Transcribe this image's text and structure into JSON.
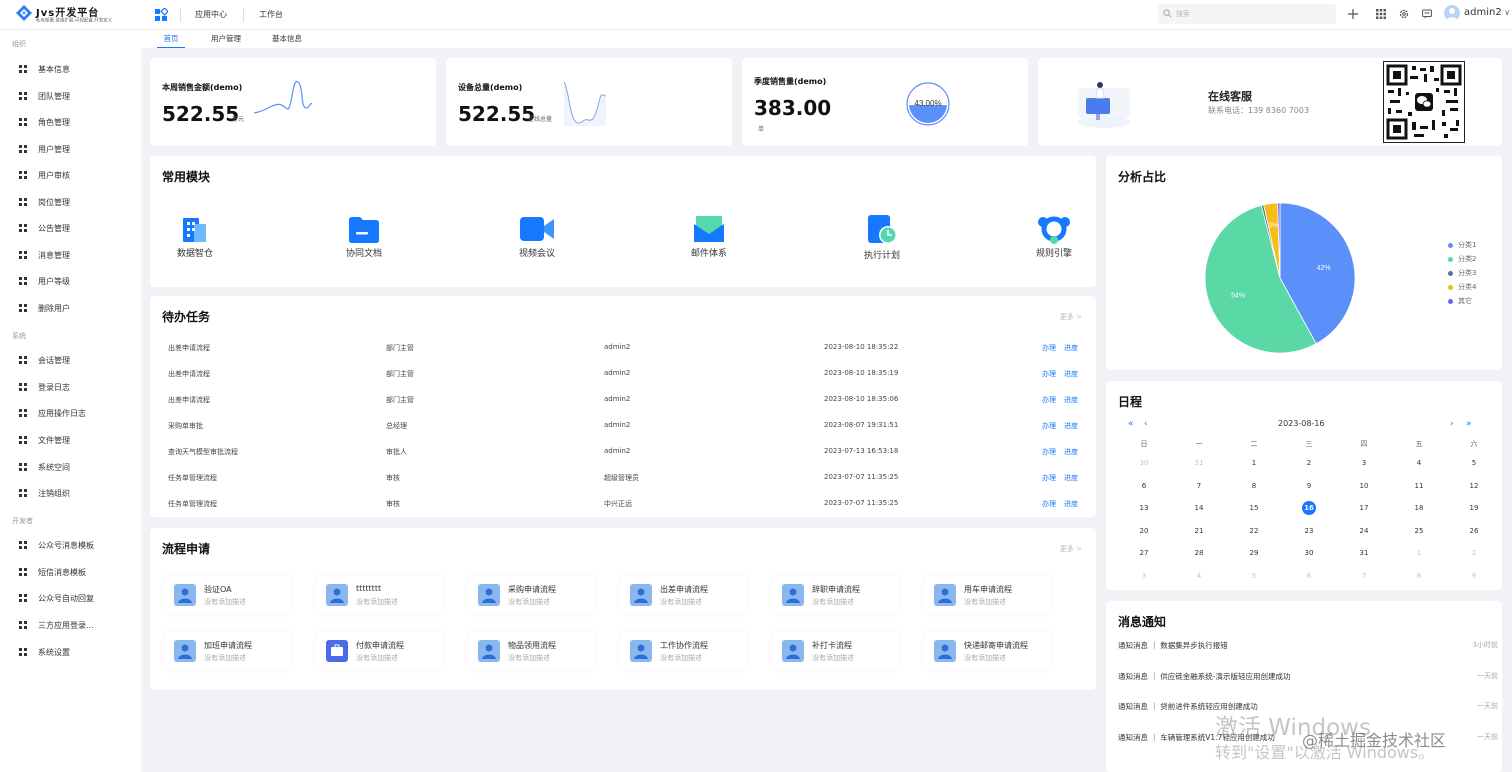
{
  "header": {
    "app_title": "Jvs开发平台",
    "app_subtitle": "私有部署,普通扩展,可视配置,开发定义",
    "nav": [
      "应用中心",
      "工作台"
    ],
    "search_placeholder": "搜索",
    "user": "admin2"
  },
  "sidebar": {
    "groups": [
      {
        "label": "组织",
        "items": [
          "基本信息",
          "团队管理",
          "角色管理",
          "用户管理",
          "用户审核",
          "岗位管理",
          "公告管理",
          "消息管理",
          "用户等级",
          "删除用户"
        ]
      },
      {
        "label": "系统",
        "items": [
          "会话管理",
          "登录日志",
          "应用操作日志",
          "文件管理",
          "系统空间",
          "注销组织"
        ]
      },
      {
        "label": "开发者",
        "items": [
          "公众号消息模板",
          "短信消息模板",
          "公众号自动回复",
          "三方应用登录...",
          "系统设置"
        ]
      }
    ]
  },
  "tabs": [
    "首页",
    "用户管理",
    "基本信息"
  ],
  "stats": [
    {
      "title": "本周销售金额(demo)",
      "value": "522.55",
      "unit": "万元"
    },
    {
      "title": "设备总量(demo)",
      "value": "522.55",
      "unit": "在线总量"
    },
    {
      "title": "季度销售量(demo)",
      "value": "383.00",
      "unit": "单",
      "gauge": "43.00%",
      "gauge_fraction": 0.43
    }
  ],
  "service": {
    "title": "在线客服",
    "phone": "联系电话：139 8360 7003"
  },
  "modules": {
    "title": "常用模块",
    "items": [
      "数据智仓",
      "协同文档",
      "视频会议",
      "邮件体系",
      "执行计划",
      "规则引擎"
    ]
  },
  "tasks": {
    "title": "待办任务",
    "more": "更多 >",
    "actions": [
      "办理",
      "进度"
    ],
    "rows": [
      [
        "出差申请流程",
        "部门主管",
        "admin2",
        "2023-08-10 18:35:22"
      ],
      [
        "出差申请流程",
        "部门主管",
        "admin2",
        "2023-08-10 18:35:19"
      ],
      [
        "出差申请流程",
        "部门主管",
        "admin2",
        "2023-08-10 18:35:06"
      ],
      [
        "采购单审批",
        "总经理",
        "admin2",
        "2023-08-07 19:31:51"
      ],
      [
        "查询天气模型审批流程",
        "审批人",
        "admin2",
        "2023-07-13 16:53:18"
      ],
      [
        "任务单管理流程",
        "审核",
        "超级管理员",
        "2023-07-07 11:35:25"
      ],
      [
        "任务单管理流程",
        "审核",
        "中兴正远",
        "2023-07-07 11:35:25"
      ]
    ]
  },
  "processes": {
    "title": "流程申请",
    "more": "更多 >",
    "desc": "没有添加描述",
    "items": [
      "验证OA",
      "tttttttt",
      "采购申请流程",
      "出差申请流程",
      "辞职申请流程",
      "用车申请流程",
      "加班申请流程",
      "付款申请流程",
      "物品领用流程",
      "工作协作流程",
      "补打卡流程",
      "快递邮寄申请流程"
    ]
  },
  "analysis": {
    "title": "分析占比"
  },
  "chart_data": {
    "type": "pie",
    "categories": [
      "分类1",
      "分类2",
      "分类3",
      "分类4",
      "其它"
    ],
    "values": [
      42,
      54,
      0.5,
      3,
      0.5
    ],
    "labels": [
      "42%",
      "54%",
      "",
      "3%",
      ""
    ],
    "colors": [
      "#5b8ff9",
      "#5ad8a6",
      "#5d7092",
      "#f6bd16",
      "#6f5ef9"
    ],
    "legend_position": "right"
  },
  "calendar": {
    "title": "日程",
    "month": "2023-08-16",
    "weekdays": [
      "日",
      "一",
      "二",
      "三",
      "四",
      "五",
      "六"
    ],
    "days": [
      "30",
      "31",
      "1",
      "2",
      "3",
      "4",
      "5",
      "6",
      "7",
      "8",
      "9",
      "10",
      "11",
      "12",
      "13",
      "14",
      "15",
      "16",
      "17",
      "18",
      "19",
      "20",
      "21",
      "22",
      "23",
      "24",
      "25",
      "26",
      "27",
      "28",
      "29",
      "30",
      "31",
      "1",
      "2",
      "3",
      "4",
      "5",
      "6",
      "7",
      "8",
      "9"
    ],
    "today": "16"
  },
  "notices": {
    "title": "消息通知",
    "items": [
      {
        "text": "通知消息 ｜ 数据集异步执行报错",
        "time": "3小时前"
      },
      {
        "text": "通知消息 ｜ 供应链金融系统-演示版轻应用创建成功",
        "time": "一天前"
      },
      {
        "text": "通知消息 ｜ 贷前进件系统轻应用创建成功",
        "time": "一天前"
      },
      {
        "text": "通知消息 ｜ 车辆管理系统V1.7轻应用创建成功",
        "time": "一天前"
      }
    ]
  },
  "overlay": {
    "activate": "激活 Windows",
    "activate_sub": "转到\"设置\"以激活 Windows。",
    "juejin": "@稀土掘金技术社区"
  }
}
